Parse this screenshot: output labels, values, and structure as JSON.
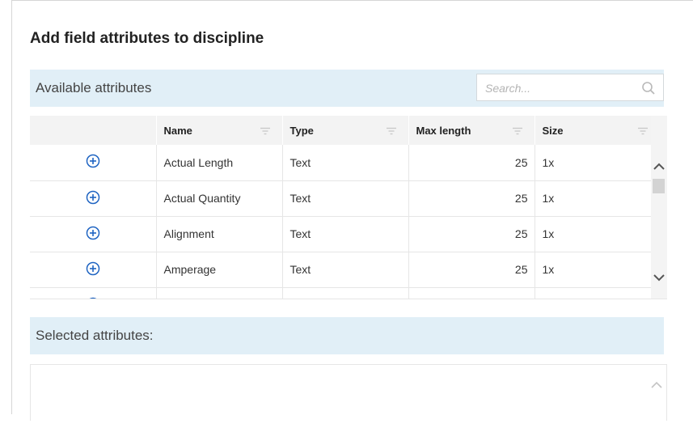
{
  "dialog": {
    "title": "Add field attributes to discipline"
  },
  "available": {
    "label": "Available attributes",
    "search_placeholder": "Search..."
  },
  "grid": {
    "columns": [
      "Name",
      "Type",
      "Max length",
      "Size"
    ],
    "rows": [
      {
        "name": "Actual Length",
        "type": "Text",
        "max_length": "25",
        "size": "1x"
      },
      {
        "name": "Actual Quantity",
        "type": "Text",
        "max_length": "25",
        "size": "1x"
      },
      {
        "name": "Alignment",
        "type": "Text",
        "max_length": "25",
        "size": "1x"
      },
      {
        "name": "Amperage",
        "type": "Text",
        "max_length": "25",
        "size": "1x"
      }
    ]
  },
  "selected": {
    "label": "Selected attributes:"
  },
  "colors": {
    "header_bg": "#e1eff7",
    "add_icon": "#1f64c2"
  }
}
